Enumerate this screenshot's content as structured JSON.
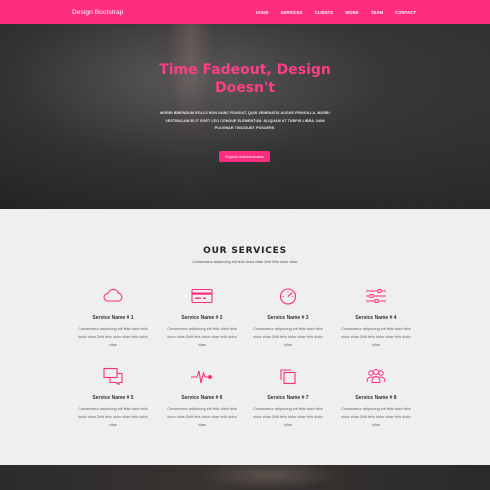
{
  "navbar": {
    "brand": "Design Bootstrap",
    "links": [
      "HOME",
      "SERVICES",
      "CLIENTS",
      "WORK",
      "TEAM",
      "CONTACT"
    ]
  },
  "hero": {
    "title_line1": "Time Fadeout, Design",
    "title_line2": "Doesn't",
    "text": "MORBI BIBENDUM ROLLS NON NUNC FEUGIAT, QUIS VENENATIS AUGUE FRINGILLA. MORBI VESTIBULUM ELIT EGET LEO CONGUE ELEMENTUM. ALIQUAM AT TURPIS LIBRA. NAM PULVINAR TINCIDUNT POSUERE.",
    "button": "Explore Awesomeness"
  },
  "services": {
    "title": "OUR SERVICES",
    "subtitle": "Consectetur adipiscing elit felis dolor vitae Zelit felis dolor vitae",
    "items": [
      {
        "name": "Service Name # 1",
        "desc": "Consectetur adipiscing elit felis dolor felis dolor vitae.Zelit felis dolor vitae felis dolor vitae",
        "icon": "cloud-icon"
      },
      {
        "name": "Service Name # 2",
        "desc": "Consectetur adipiscing elit felis dolor felis dolor vitae.Zelit felis dolor vitae felis dolor vitae",
        "icon": "credit-card-icon"
      },
      {
        "name": "Service Name # 3",
        "desc": "Consectetur adipiscing elit felis dolor felis dolor vitae.Zelit felis dolor vitae felis dolor vitae",
        "icon": "speedometer-icon"
      },
      {
        "name": "Service Name # 4",
        "desc": "Consectetur adipiscing elit felis dolor felis dolor vitae.Zelit felis dolor vitae felis dolor vitae",
        "icon": "sliders-icon"
      },
      {
        "name": "Service Name # 5",
        "desc": "Consectetur adipiscing elit felis dolor felis dolor vitae.Zelit felis dolor vitae felis dolor vitae",
        "icon": "chat-icon"
      },
      {
        "name": "Service Name # 6",
        "desc": "Consectetur adipiscing elit felis dolor felis dolor vitae.Zelit felis dolor vitae felis dolor vitae",
        "icon": "pulse-icon"
      },
      {
        "name": "Service Name # 7",
        "desc": "Consectetur adipiscing elit felis dolor felis dolor vitae.Zelit felis dolor vitae felis dolor vitae",
        "icon": "copy-icon"
      },
      {
        "name": "Service Name # 8",
        "desc": "Consectetur adipiscing elit felis dolor felis dolor vitae.Zelit felis dolor vitae felis dolor vitae",
        "icon": "team-icon"
      }
    ]
  },
  "colors": {
    "accent": "#ff2d7d",
    "hero_bg": "#333333",
    "section_bg": "#efefef"
  }
}
